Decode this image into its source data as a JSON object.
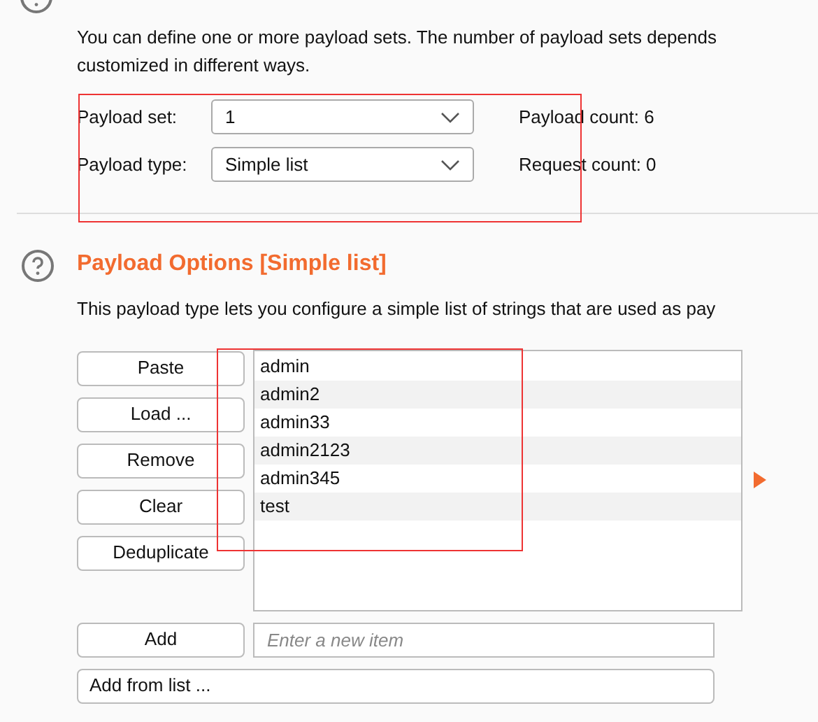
{
  "intro": "You can define one or more payload sets. The number of payload sets depends",
  "intro_line2": "customized in different ways.",
  "settings": [
    {
      "label": "Payload set:",
      "value": "1",
      "count": "Payload count: 6"
    },
    {
      "label": "Payload type:",
      "value": "Simple list",
      "count": "Request count: 0"
    }
  ],
  "options": {
    "title": "Payload Options [Simple list]",
    "description": "This payload type lets you configure a simple list of strings that are used as pay",
    "buttons": [
      "Paste",
      "Load ...",
      "Remove",
      "Clear",
      "Deduplicate"
    ],
    "items": [
      "admin",
      "admin2",
      "admin33",
      "admin2123",
      "admin345",
      "test"
    ],
    "add_button": "Add",
    "new_item": {
      "placeholder": "Enter a new item"
    },
    "add_from_list": "Add from list ..."
  }
}
